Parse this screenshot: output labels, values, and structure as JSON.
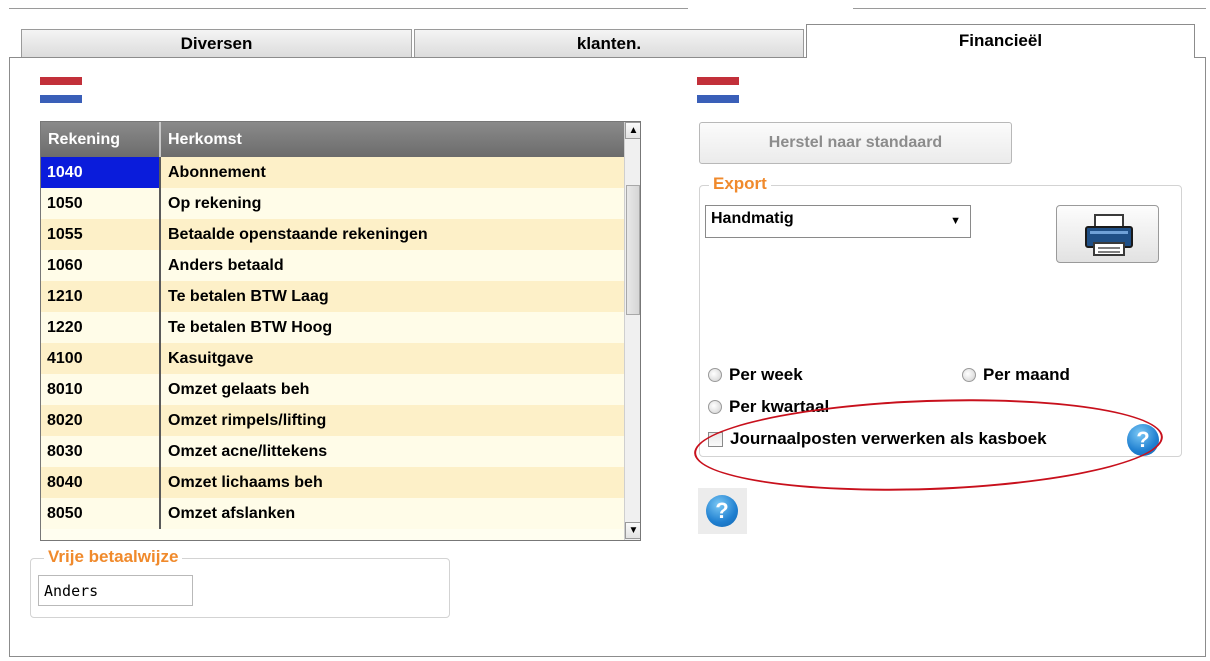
{
  "tabs": [
    {
      "label": "Diversen"
    },
    {
      "label": "klanten."
    },
    {
      "label": "Financieël"
    }
  ],
  "table": {
    "columns": [
      "Rekening",
      "Herkomst"
    ],
    "rows": [
      {
        "rekening": "1040",
        "herkomst": "Abonnement"
      },
      {
        "rekening": "1050",
        "herkomst": "Op rekening"
      },
      {
        "rekening": "1055",
        "herkomst": "Betaalde openstaande rekeningen"
      },
      {
        "rekening": "1060",
        "herkomst": "Anders betaald"
      },
      {
        "rekening": "1210",
        "herkomst": "Te betalen BTW Laag"
      },
      {
        "rekening": "1220",
        "herkomst": "Te betalen BTW Hoog"
      },
      {
        "rekening": "4100",
        "herkomst": "Kasuitgave"
      },
      {
        "rekening": "8010",
        "herkomst": "Omzet gelaats beh"
      },
      {
        "rekening": "8020",
        "herkomst": "Omzet rimpels/lifting"
      },
      {
        "rekening": "8030",
        "herkomst": "Omzet acne/littekens"
      },
      {
        "rekening": "8040",
        "herkomst": "Omzet lichaams beh"
      },
      {
        "rekening": "8050",
        "herkomst": "Omzet afslanken"
      }
    ]
  },
  "vrije_betaalwijze": {
    "legend": "Vrije betaalwijze",
    "value": "Anders"
  },
  "herstel_button": "Herstel naar standaard",
  "export": {
    "legend": "Export",
    "select_value": "Handmatig",
    "radio_week": "Per week",
    "radio_maand": "Per maand",
    "radio_kwartaal": "Per kwartaal",
    "checkbox_label": "Journaalposten verwerken als kasboek"
  },
  "help_glyph": "?",
  "colors": {
    "accent_legend": "#f08a2c",
    "selected_cell": "#0a1cdb",
    "highlight_ellipse": "#c8101c"
  }
}
